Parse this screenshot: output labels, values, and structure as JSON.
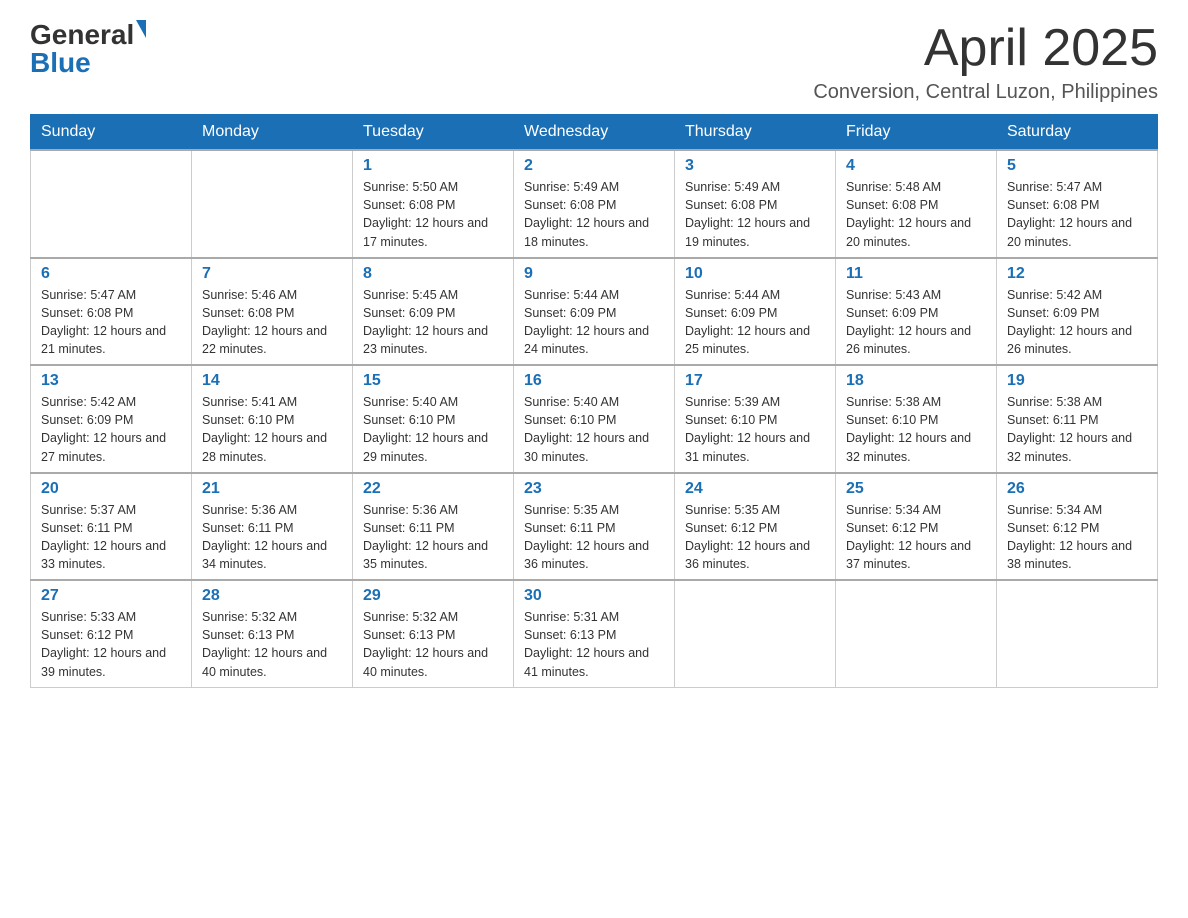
{
  "header": {
    "logo_general": "General",
    "logo_blue": "Blue",
    "month_title": "April 2025",
    "location": "Conversion, Central Luzon, Philippines"
  },
  "days_of_week": [
    "Sunday",
    "Monday",
    "Tuesday",
    "Wednesday",
    "Thursday",
    "Friday",
    "Saturday"
  ],
  "weeks": [
    [
      {
        "day": "",
        "sunrise": "",
        "sunset": "",
        "daylight": ""
      },
      {
        "day": "",
        "sunrise": "",
        "sunset": "",
        "daylight": ""
      },
      {
        "day": "1",
        "sunrise": "Sunrise: 5:50 AM",
        "sunset": "Sunset: 6:08 PM",
        "daylight": "Daylight: 12 hours and 17 minutes."
      },
      {
        "day": "2",
        "sunrise": "Sunrise: 5:49 AM",
        "sunset": "Sunset: 6:08 PM",
        "daylight": "Daylight: 12 hours and 18 minutes."
      },
      {
        "day": "3",
        "sunrise": "Sunrise: 5:49 AM",
        "sunset": "Sunset: 6:08 PM",
        "daylight": "Daylight: 12 hours and 19 minutes."
      },
      {
        "day": "4",
        "sunrise": "Sunrise: 5:48 AM",
        "sunset": "Sunset: 6:08 PM",
        "daylight": "Daylight: 12 hours and 20 minutes."
      },
      {
        "day": "5",
        "sunrise": "Sunrise: 5:47 AM",
        "sunset": "Sunset: 6:08 PM",
        "daylight": "Daylight: 12 hours and 20 minutes."
      }
    ],
    [
      {
        "day": "6",
        "sunrise": "Sunrise: 5:47 AM",
        "sunset": "Sunset: 6:08 PM",
        "daylight": "Daylight: 12 hours and 21 minutes."
      },
      {
        "day": "7",
        "sunrise": "Sunrise: 5:46 AM",
        "sunset": "Sunset: 6:08 PM",
        "daylight": "Daylight: 12 hours and 22 minutes."
      },
      {
        "day": "8",
        "sunrise": "Sunrise: 5:45 AM",
        "sunset": "Sunset: 6:09 PM",
        "daylight": "Daylight: 12 hours and 23 minutes."
      },
      {
        "day": "9",
        "sunrise": "Sunrise: 5:44 AM",
        "sunset": "Sunset: 6:09 PM",
        "daylight": "Daylight: 12 hours and 24 minutes."
      },
      {
        "day": "10",
        "sunrise": "Sunrise: 5:44 AM",
        "sunset": "Sunset: 6:09 PM",
        "daylight": "Daylight: 12 hours and 25 minutes."
      },
      {
        "day": "11",
        "sunrise": "Sunrise: 5:43 AM",
        "sunset": "Sunset: 6:09 PM",
        "daylight": "Daylight: 12 hours and 26 minutes."
      },
      {
        "day": "12",
        "sunrise": "Sunrise: 5:42 AM",
        "sunset": "Sunset: 6:09 PM",
        "daylight": "Daylight: 12 hours and 26 minutes."
      }
    ],
    [
      {
        "day": "13",
        "sunrise": "Sunrise: 5:42 AM",
        "sunset": "Sunset: 6:09 PM",
        "daylight": "Daylight: 12 hours and 27 minutes."
      },
      {
        "day": "14",
        "sunrise": "Sunrise: 5:41 AM",
        "sunset": "Sunset: 6:10 PM",
        "daylight": "Daylight: 12 hours and 28 minutes."
      },
      {
        "day": "15",
        "sunrise": "Sunrise: 5:40 AM",
        "sunset": "Sunset: 6:10 PM",
        "daylight": "Daylight: 12 hours and 29 minutes."
      },
      {
        "day": "16",
        "sunrise": "Sunrise: 5:40 AM",
        "sunset": "Sunset: 6:10 PM",
        "daylight": "Daylight: 12 hours and 30 minutes."
      },
      {
        "day": "17",
        "sunrise": "Sunrise: 5:39 AM",
        "sunset": "Sunset: 6:10 PM",
        "daylight": "Daylight: 12 hours and 31 minutes."
      },
      {
        "day": "18",
        "sunrise": "Sunrise: 5:38 AM",
        "sunset": "Sunset: 6:10 PM",
        "daylight": "Daylight: 12 hours and 32 minutes."
      },
      {
        "day": "19",
        "sunrise": "Sunrise: 5:38 AM",
        "sunset": "Sunset: 6:11 PM",
        "daylight": "Daylight: 12 hours and 32 minutes."
      }
    ],
    [
      {
        "day": "20",
        "sunrise": "Sunrise: 5:37 AM",
        "sunset": "Sunset: 6:11 PM",
        "daylight": "Daylight: 12 hours and 33 minutes."
      },
      {
        "day": "21",
        "sunrise": "Sunrise: 5:36 AM",
        "sunset": "Sunset: 6:11 PM",
        "daylight": "Daylight: 12 hours and 34 minutes."
      },
      {
        "day": "22",
        "sunrise": "Sunrise: 5:36 AM",
        "sunset": "Sunset: 6:11 PM",
        "daylight": "Daylight: 12 hours and 35 minutes."
      },
      {
        "day": "23",
        "sunrise": "Sunrise: 5:35 AM",
        "sunset": "Sunset: 6:11 PM",
        "daylight": "Daylight: 12 hours and 36 minutes."
      },
      {
        "day": "24",
        "sunrise": "Sunrise: 5:35 AM",
        "sunset": "Sunset: 6:12 PM",
        "daylight": "Daylight: 12 hours and 36 minutes."
      },
      {
        "day": "25",
        "sunrise": "Sunrise: 5:34 AM",
        "sunset": "Sunset: 6:12 PM",
        "daylight": "Daylight: 12 hours and 37 minutes."
      },
      {
        "day": "26",
        "sunrise": "Sunrise: 5:34 AM",
        "sunset": "Sunset: 6:12 PM",
        "daylight": "Daylight: 12 hours and 38 minutes."
      }
    ],
    [
      {
        "day": "27",
        "sunrise": "Sunrise: 5:33 AM",
        "sunset": "Sunset: 6:12 PM",
        "daylight": "Daylight: 12 hours and 39 minutes."
      },
      {
        "day": "28",
        "sunrise": "Sunrise: 5:32 AM",
        "sunset": "Sunset: 6:13 PM",
        "daylight": "Daylight: 12 hours and 40 minutes."
      },
      {
        "day": "29",
        "sunrise": "Sunrise: 5:32 AM",
        "sunset": "Sunset: 6:13 PM",
        "daylight": "Daylight: 12 hours and 40 minutes."
      },
      {
        "day": "30",
        "sunrise": "Sunrise: 5:31 AM",
        "sunset": "Sunset: 6:13 PM",
        "daylight": "Daylight: 12 hours and 41 minutes."
      },
      {
        "day": "",
        "sunrise": "",
        "sunset": "",
        "daylight": ""
      },
      {
        "day": "",
        "sunrise": "",
        "sunset": "",
        "daylight": ""
      },
      {
        "day": "",
        "sunrise": "",
        "sunset": "",
        "daylight": ""
      }
    ]
  ]
}
